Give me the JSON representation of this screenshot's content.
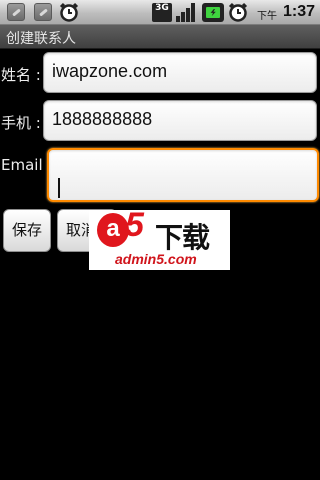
{
  "status_bar": {
    "network_label": "3G",
    "ampm": "下午",
    "time": "1:37"
  },
  "title_bar": {
    "title": "创建联系人"
  },
  "form": {
    "name_label": "姓名 :",
    "name_value": "iwapzone.com",
    "phone_label": "手机 :",
    "phone_value": "1888888888",
    "email_label": "Email :",
    "email_value": ""
  },
  "buttons": {
    "save_label": "保存",
    "cancel_label": "取消"
  },
  "watermark": {
    "logo_letter": "a",
    "logo_number": "5",
    "logo_text": "下载",
    "url": "admin5.com"
  },
  "colors": {
    "focus": "#ff8a00",
    "watermark_red": "#e0161d"
  }
}
